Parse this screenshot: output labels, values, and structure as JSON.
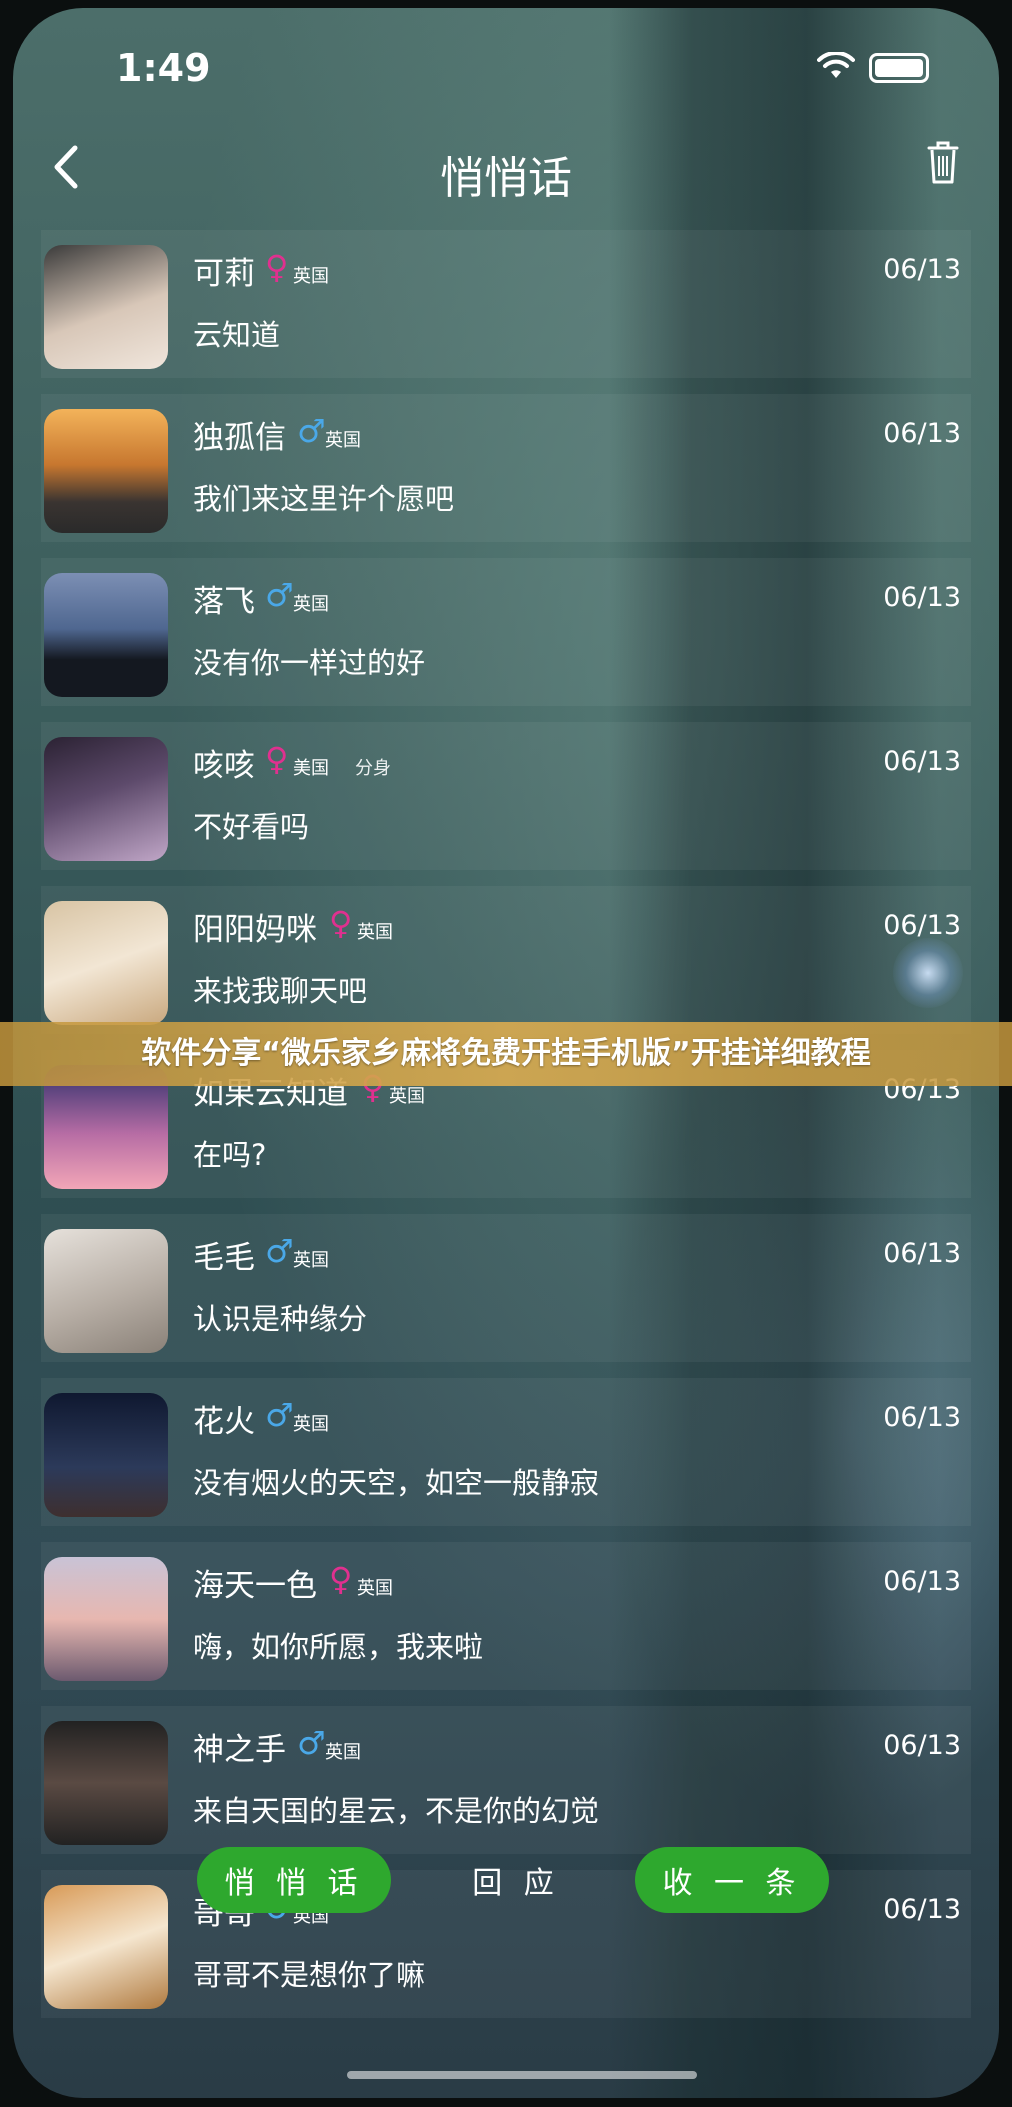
{
  "status_bar": {
    "time": "1:49"
  },
  "nav": {
    "title": "悄悄话"
  },
  "messages": [
    {
      "name": "可莉",
      "gender": "female",
      "country": "英国",
      "tag": "",
      "date": "06/13",
      "text": "云知道"
    },
    {
      "name": "独孤信",
      "gender": "male",
      "country": "英国",
      "tag": "",
      "date": "06/13",
      "text": "我们来这里许个愿吧"
    },
    {
      "name": "落飞",
      "gender": "male",
      "country": "英国",
      "tag": "",
      "date": "06/13",
      "text": "没有你一样过的好"
    },
    {
      "name": "咳咳",
      "gender": "female",
      "country": "美国",
      "tag": "分身",
      "date": "06/13",
      "text": "不好看吗"
    },
    {
      "name": "阳阳妈咪",
      "gender": "female",
      "country": "英国",
      "tag": "",
      "date": "06/13",
      "text": "来找我聊天吧"
    },
    {
      "name": "如果云知道",
      "gender": "female",
      "country": "英国",
      "tag": "",
      "date": "06/13",
      "text": "在吗?"
    },
    {
      "name": "毛毛",
      "gender": "male",
      "country": "英国",
      "tag": "",
      "date": "06/13",
      "text": "认识是种缘分"
    },
    {
      "name": "花火",
      "gender": "male",
      "country": "英国",
      "tag": "",
      "date": "06/13",
      "text": "没有烟火的天空，如空一般静寂"
    },
    {
      "name": "海天一色",
      "gender": "female",
      "country": "英国",
      "tag": "",
      "date": "06/13",
      "text": "嗨，如你所愿，我来啦"
    },
    {
      "name": "神之手",
      "gender": "male",
      "country": "英国",
      "tag": "",
      "date": "06/13",
      "text": "来自天国的星云，不是你的幻觉"
    },
    {
      "name": "哥哥",
      "gender": "male",
      "country": "英国",
      "tag": "",
      "date": "06/13",
      "text": "哥哥不是想你了嘛"
    }
  ],
  "gender_symbols": {
    "female": "♀",
    "male": "♂"
  },
  "banner": {
    "text": "软件分享“微乐家乡麻将免费开挂手机版”开挂详细教程"
  },
  "bottom_bar": {
    "whisper_label": "悄 悄 话",
    "reply_label": "回 应",
    "collect_label": "收 一 条"
  },
  "colors": {
    "female": "#e0308f",
    "male": "#4aa8e8",
    "button_green": "#2ea82e",
    "banner": "#d4a650"
  }
}
